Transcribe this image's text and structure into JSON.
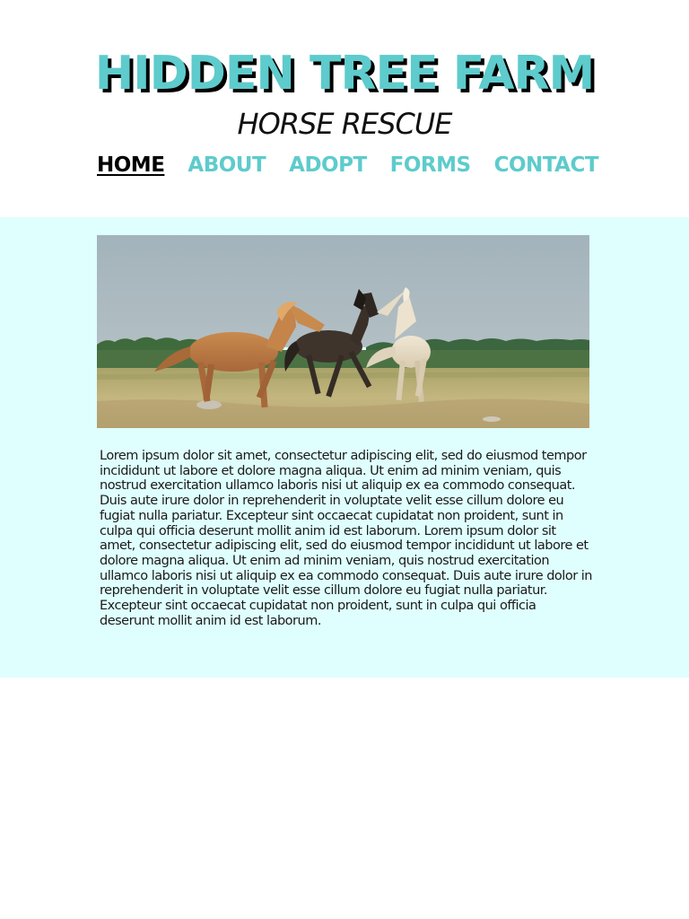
{
  "header": {
    "title": "HIDDEN TREE FARM",
    "subtitle": "HORSE RESCUE"
  },
  "nav": {
    "items": [
      {
        "label": "HOME",
        "active": true
      },
      {
        "label": "ABOUT",
        "active": false
      },
      {
        "label": "ADOPT",
        "active": false
      },
      {
        "label": "FORMS",
        "active": false
      },
      {
        "label": "CONTACT",
        "active": false
      }
    ]
  },
  "hero": {
    "image": "three-horses-galloping-in-field"
  },
  "main": {
    "body": "Lorem ipsum dolor sit amet, consectetur adipiscing elit, sed do eiusmod tempor incididunt ut labore et dolore magna aliqua. Ut enim ad minim veniam, quis nostrud exercitation ullamco laboris nisi ut aliquip ex ea commodo consequat. Duis aute irure dolor in reprehenderit in voluptate velit esse cillum dolore eu fugiat nulla pariatur. Excepteur sint occaecat cupidatat non proident, sunt in culpa qui officia deserunt mollit anim id est laborum. Lorem ipsum dolor sit amet, consectetur adipiscing elit, sed do eiusmod tempor incididunt ut labore et dolore magna aliqua. Ut enim ad minim veniam, quis nostrud exercitation ullamco laboris nisi ut aliquip ex ea commodo consequat. Duis aute irure dolor in reprehenderit in voluptate velit esse cillum dolore eu fugiat nulla pariatur. Excepteur sint occaecat cupidatat non proident, sunt in culpa qui officia deserunt mollit anim id est laborum."
  },
  "colors": {
    "accent": "#5ecbcc",
    "content_background": "#dffffe",
    "title_shadow": "#000000",
    "active_nav": "#000000"
  }
}
